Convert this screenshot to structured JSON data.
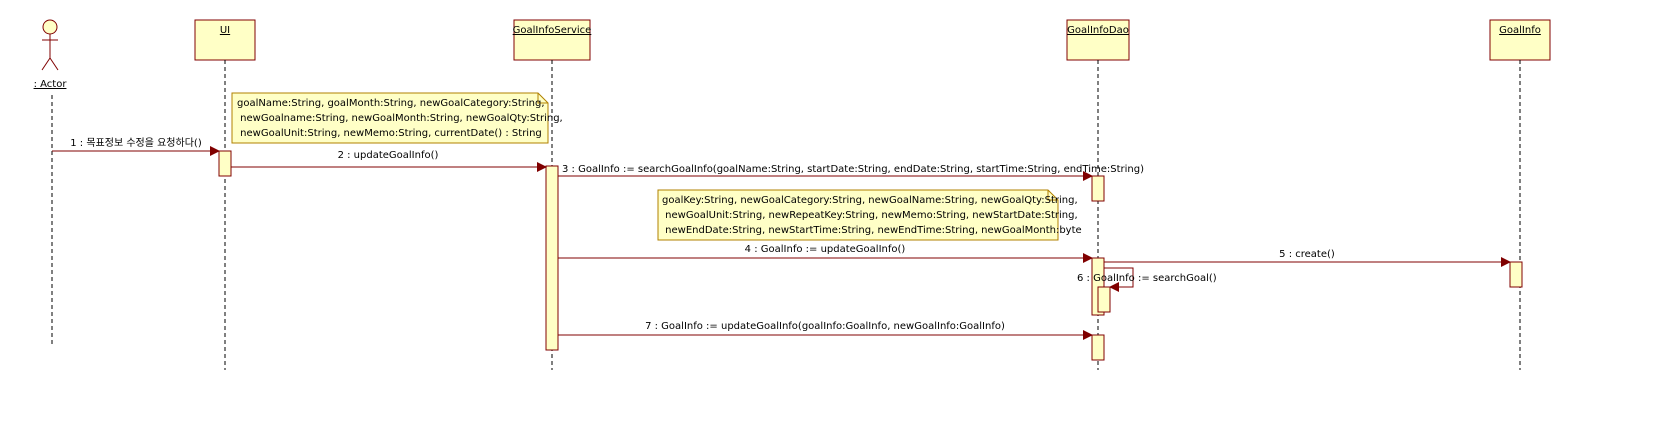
{
  "diagram": {
    "type": "sequence",
    "colors": {
      "border": "#800000",
      "fill": "#ffffc6",
      "note_border": "#b08000"
    },
    "actor": {
      "label": ": Actor"
    },
    "lifelines": [
      {
        "id": "ui",
        "label": "UI"
      },
      {
        "id": "service",
        "label": "GoalInfoService"
      },
      {
        "id": "dao",
        "label": "GoalInfoDao"
      },
      {
        "id": "goalinfo",
        "label": "GoalInfo"
      }
    ],
    "notes": [
      {
        "lines": [
          "goalName:String, goalMonth:String, newGoalCategory:String,",
          " newGoalname:String, newGoalMonth:String, newGoalQty:String,",
          " newGoalUnit:String, newMemo:String, currentDate() : String"
        ]
      },
      {
        "lines": [
          "goalKey:String, newGoalCategory:String, newGoalName:String, newGoalQty:String,",
          " newGoalUnit:String, newRepeatKey:String, newMemo:String, newStartDate:String,",
          " newEndDate:String, newStartTime:String, newEndTime:String, newGoalMonth:byte"
        ]
      }
    ],
    "messages": [
      {
        "label": "1 : 목표정보 수정을 요청하다()",
        "from": "actor",
        "to": "ui"
      },
      {
        "label": "2 : updateGoalInfo()",
        "from": "ui",
        "to": "service"
      },
      {
        "label": "3 : GoalInfo := searchGoalInfo(goalName:String, startDate:String, endDate:String, startTime:String, endTime:String)",
        "from": "service",
        "to": "dao"
      },
      {
        "label": "4 : GoalInfo := updateGoalInfo()",
        "from": "service",
        "to": "dao"
      },
      {
        "label": "5 : create()",
        "from": "dao",
        "to": "goalinfo"
      },
      {
        "label": "6 : GoalInfo := searchGoal()",
        "from": "dao",
        "to": "dao"
      },
      {
        "label": "7 : GoalInfo := updateGoalInfo(goalInfo:GoalInfo, newGoalInfo:GoalInfo)",
        "from": "service",
        "to": "dao"
      }
    ]
  }
}
